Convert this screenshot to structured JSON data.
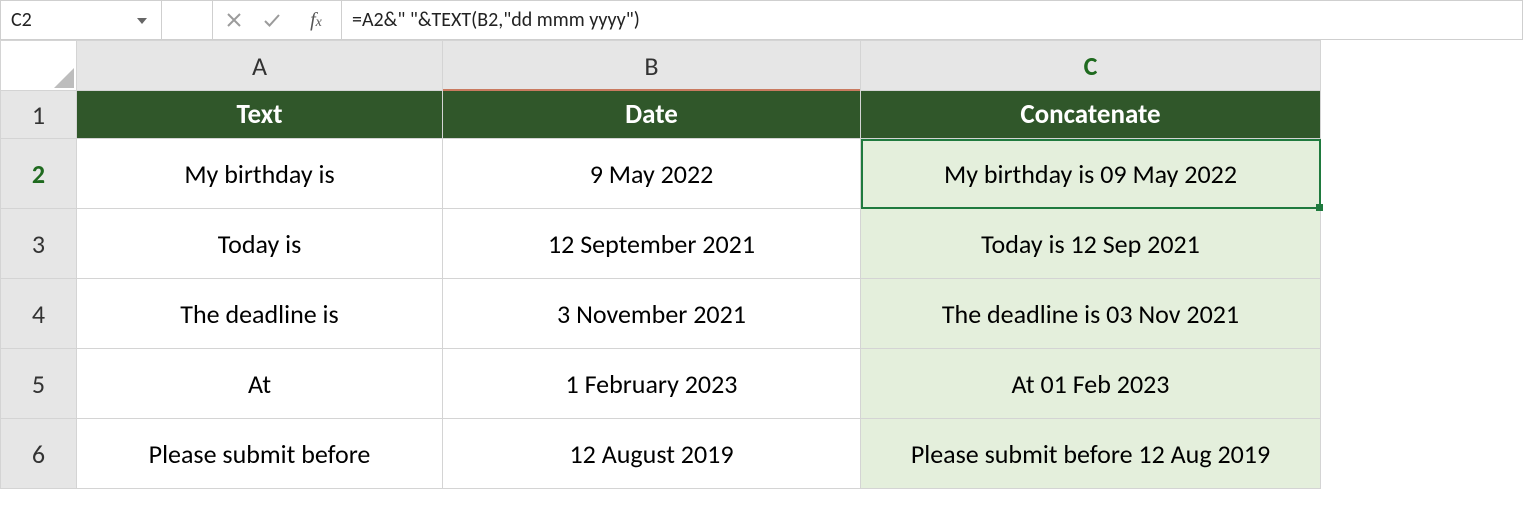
{
  "formula_bar": {
    "name_box": "C2",
    "formula": "=A2&\" \"&TEXT(B2,\"dd mmm yyyy\")"
  },
  "columns": {
    "A": "A",
    "B": "B",
    "C": "C"
  },
  "row_numbers": [
    "1",
    "2",
    "3",
    "4",
    "5",
    "6"
  ],
  "headers": {
    "text": "Text",
    "date": "Date",
    "concat": "Concatenate"
  },
  "rows": [
    {
      "text": "My birthday is",
      "date": "9 May 2022",
      "concat": "My birthday is 09 May 2022"
    },
    {
      "text": "Today is",
      "date": "12 September 2021",
      "concat": "Today is 12 Sep 2021"
    },
    {
      "text": "The deadline is",
      "date": "3 November 2021",
      "concat": "The deadline is 03 Nov 2021"
    },
    {
      "text": "At",
      "date": "1 February 2023",
      "concat": "At 01 Feb 2023"
    },
    {
      "text": "Please submit before",
      "date": "12 August 2019",
      "concat": "Please submit before 12 Aug 2019"
    }
  ],
  "active_cell": "C2"
}
